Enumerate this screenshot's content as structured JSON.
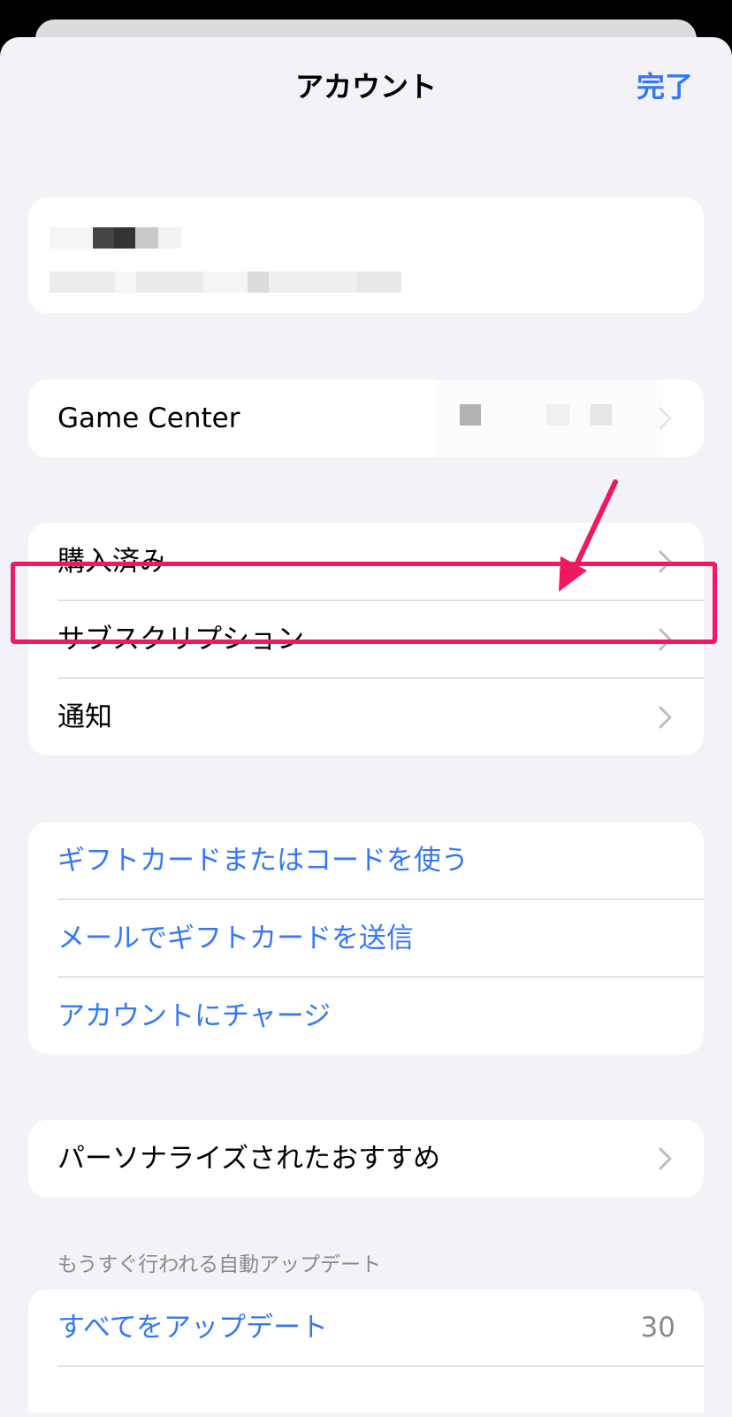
{
  "nav": {
    "title": "アカウント",
    "done_label": "完了"
  },
  "game_center": {
    "label": "Game Center"
  },
  "media_rows": [
    {
      "label": "購入済み"
    },
    {
      "label": "サブスクリプション"
    },
    {
      "label": "通知"
    }
  ],
  "gift_rows": [
    {
      "label": "ギフトカードまたはコードを使う"
    },
    {
      "label": "メールでギフトカードを送信"
    },
    {
      "label": "アカウントにチャージ"
    }
  ],
  "personalized": {
    "label": "パーソナライズされたおすすめ"
  },
  "updates": {
    "section_header": "もうすぐ行われる自動アップデート",
    "update_all_label": "すべてをアップデート",
    "count": "30"
  },
  "colors": {
    "accent": "#3478f6",
    "highlight": "#f0185f",
    "background": "#f2f2f7"
  },
  "icons": [
    "chevron-right-icon",
    "arrow-annotation-icon"
  ]
}
